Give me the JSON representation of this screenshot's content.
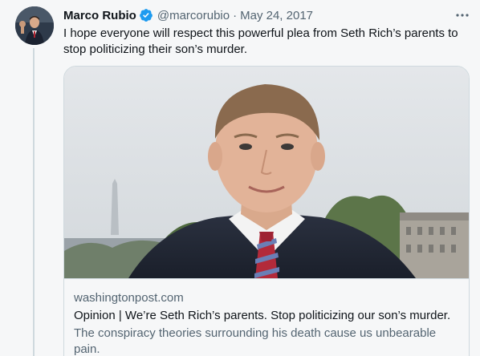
{
  "tweet": {
    "display_name": "Marco Rubio",
    "handle": "@marcorubio",
    "separator": "·",
    "date": "May 24, 2017",
    "more_label": "•••",
    "text": "I hope everyone will respect this powerful plea from Seth Rich’s parents to stop politicizing their son’s murder.",
    "avatar_icon": "profile-photo",
    "verified_icon": "verified-badge-icon"
  },
  "card": {
    "domain": "washingtonpost.com",
    "title": "Opinion | We’re Seth Rich’s parents. Stop politicizing our son’s murder.",
    "description": "The conspiracy theories surrounding his death cause us unbearable pain."
  },
  "colors": {
    "verified_blue": "#1d9bf0",
    "secondary_text": "#536471",
    "border": "#cfd9de"
  }
}
